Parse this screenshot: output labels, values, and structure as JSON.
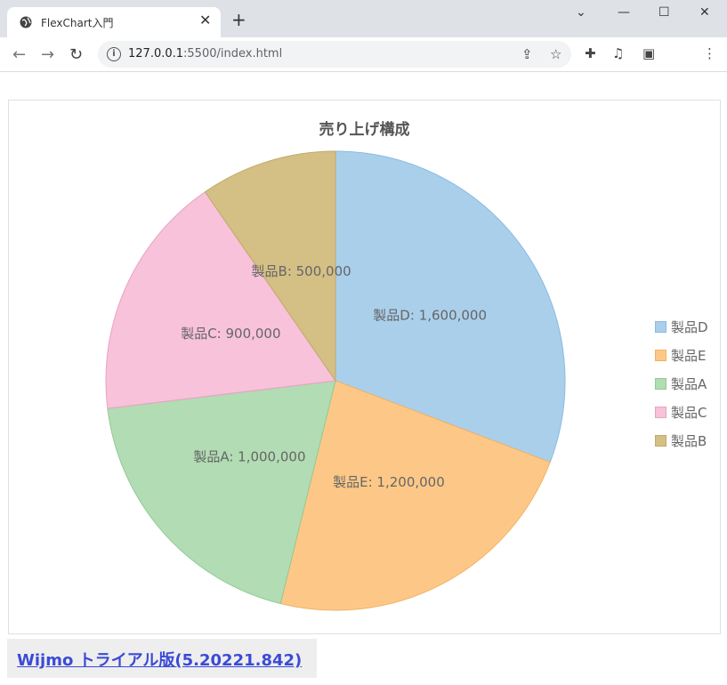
{
  "browser": {
    "tab_title": "FlexChart入門",
    "tab_close": "✕",
    "new_tab": "+",
    "url_host": "127.0.0.1",
    "url_rest": ":5500/index.html"
  },
  "chart_data": {
    "type": "pie",
    "title": "売り上げ構成",
    "categories": [
      "製品D",
      "製品E",
      "製品A",
      "製品C",
      "製品B"
    ],
    "values": [
      1600000,
      1200000,
      1000000,
      900000,
      500000
    ],
    "data_labels": [
      "製品D: 1,600,000",
      "製品E: 1,200,000",
      "製品A: 1,000,000",
      "製品C: 900,000",
      "製品B: 500,000"
    ],
    "colors": [
      "#aacfeb",
      "#fdc887",
      "#b2dcb3",
      "#f7c2da",
      "#d4bf85"
    ],
    "border_colors": [
      "#88bbe3",
      "#f2b260",
      "#94c995",
      "#e8a3c3",
      "#c2aa6a"
    ],
    "legend_position": "right"
  },
  "trial_link": "Wijmo トライアル版(5.20221.842)"
}
